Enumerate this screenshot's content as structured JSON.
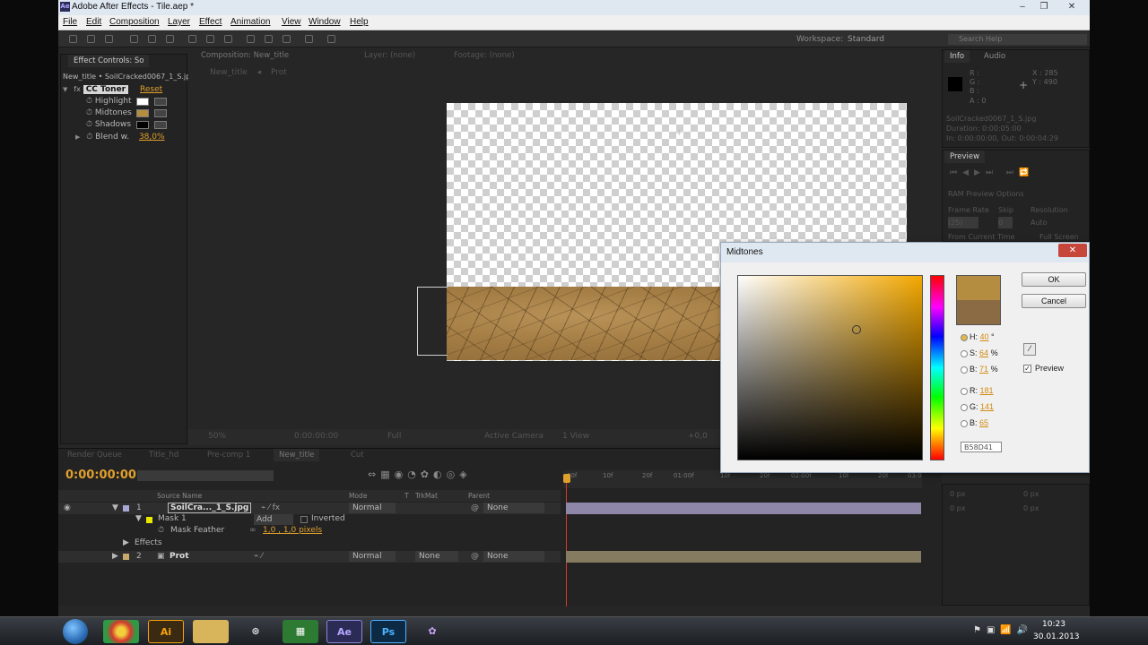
{
  "window": {
    "title": "Adobe After Effects - Tile.aep *"
  },
  "menu": [
    "File",
    "Edit",
    "Composition",
    "Layer",
    "Effect",
    "Animation",
    "View",
    "Window",
    "Help"
  ],
  "toolbar": {
    "workspace_label": "Workspace:",
    "workspace_value": "Standard",
    "search_placeholder": "Search Help"
  },
  "effect_controls": {
    "tab": "Effect Controls: So",
    "header": "New_title • SoilCracked0067_1_S.jpg",
    "effect_name": "CC Toner",
    "reset": "Reset",
    "props": [
      {
        "label": "Highlight",
        "color": "#ffffff"
      },
      {
        "label": "Midtones",
        "color": "#b58d41"
      },
      {
        "label": "Shadows",
        "color": "#000000"
      },
      {
        "label": "Blend w.",
        "value": "38,0%"
      }
    ]
  },
  "composition": {
    "tabs": [
      "Composition: New_title",
      "Layer: (none)",
      "Footage: (none)"
    ],
    "breadcrumb": [
      "New_title",
      "Prot"
    ],
    "bottom": {
      "zoom": "50%",
      "time": "0:00:00:00",
      "res": "Full",
      "camera": "Active Camera",
      "views": "1 View",
      "exposure": "+0,0"
    }
  },
  "info_panel": {
    "tabs": [
      "Info",
      "Audio"
    ],
    "r": "R :",
    "g": "G :",
    "b": "B :",
    "a": "A : 0",
    "x": "X : 285",
    "y": "Y : 490",
    "file": "SoilCracked0067_1_S.jpg",
    "duration": "Duration: 0:00:05:00",
    "inout": "In: 0:00:00:00, Out: 0:00:04:29"
  },
  "preview_panel": {
    "tab": "Preview",
    "ram": "RAM Preview Options",
    "frame_rate": "Frame Rate",
    "skip": "Skip",
    "resolution": "Resolution",
    "fr_val": "(25)",
    "skip_val": "0",
    "res_val": "Auto",
    "from_current": "From Current Time",
    "full_screen": "Full Screen"
  },
  "dialog": {
    "title": "Midtones",
    "ok": "OK",
    "cancel": "Cancel",
    "preview": "Preview",
    "h_label": "H:",
    "h": "40",
    "h_unit": "°",
    "s_label": "S:",
    "s": "64",
    "s_unit": "%",
    "b_label": "B:",
    "b": "71",
    "b_unit": "%",
    "r_label": "R:",
    "r": "181",
    "g_label": "G:",
    "g": "141",
    "bb_label": "B:",
    "bb": "65",
    "hex": "B58D41",
    "new_color": "#b58d41",
    "old_color": "#8a6b44"
  },
  "timeline": {
    "tabs": [
      "Render Queue",
      "Title_hd",
      "Pre-comp 1",
      "New_title",
      "Cut"
    ],
    "timecode": "0:00:00:00",
    "columns": {
      "source": "Source Name",
      "mode": "Mode",
      "t": "T",
      "trkmat": "TrkMat",
      "parent": "Parent"
    },
    "ruler": [
      "00f",
      "10f",
      "20f",
      "01:00f",
      "10f",
      "20f",
      "02:00f",
      "10f",
      "20f",
      "03:0"
    ],
    "layers": [
      {
        "num": "1",
        "name": "SoilCra..._1_S.jpg",
        "mode": "Normal",
        "trkmat": "",
        "parent": "None"
      },
      {
        "num": "2",
        "name": "Prot",
        "mode": "Normal",
        "trkmat": "None",
        "parent": "None"
      }
    ],
    "mask": {
      "name": "Mask 1",
      "mode": "Add",
      "inverted": "Inverted"
    },
    "feather": {
      "label": "Mask Feather",
      "value": "1,0 , 1,0 pixels"
    },
    "effects": "Effects"
  },
  "align_panel": {
    "a": "0 px",
    "b": "0 px",
    "c": "0 px",
    "d": "0 px"
  },
  "taskbar": {
    "apps": [
      "Ai",
      "Ae",
      "Ps"
    ],
    "time": "10:23",
    "date": "30.01.2013"
  }
}
